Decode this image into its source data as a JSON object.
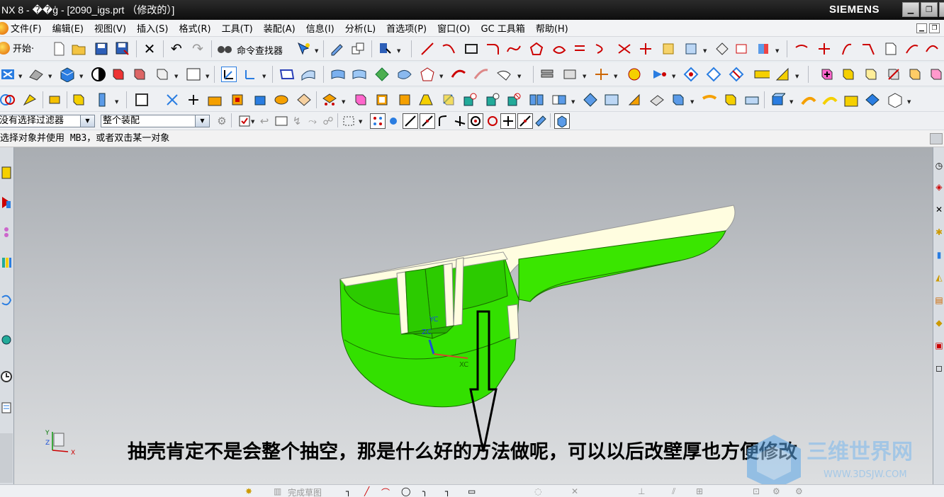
{
  "window": {
    "title": "NX 8 - ��ģ - [2090_igs.prt （修改的）]",
    "brand": "SIEMENS",
    "controls": {
      "minimize": "▁",
      "restore": "❐",
      "close": "✕"
    }
  },
  "menubar": {
    "items": [
      "文件(F)",
      "编辑(E)",
      "视图(V)",
      "插入(S)",
      "格式(R)",
      "工具(T)",
      "装配(A)",
      "信息(I)",
      "分析(L)",
      "首选项(P)",
      "窗口(O)",
      "GC 工具箱",
      "帮助(H)"
    ]
  },
  "toolbar": {
    "start_label": "开始·",
    "finder_label": "命令查找器"
  },
  "selection": {
    "filter_value": "没有选择过滤器",
    "scope_value": "整个装配"
  },
  "cue_line": "选择对象并使用 MB3，或者双击某一对象",
  "viewport": {
    "wcs_labels": {
      "yc": "YC",
      "zc": "ZC",
      "xc": "XC"
    },
    "triad_labels": {
      "y": "Y",
      "z": "Z",
      "x": "X"
    }
  },
  "annotation": "抽壳肯定不是会整个抽空，那是什么好的方法做呢，可以以后改壁厚也方便修改",
  "bottom_toolbar": {
    "finish_sketch_label": "完成草图"
  },
  "watermark": {
    "text": "三维世界网",
    "url": "WWW.3DSJW.COM"
  },
  "colors": {
    "part_green": "#33e000",
    "part_cream": "#fffde0",
    "titlebar": "#111111"
  }
}
